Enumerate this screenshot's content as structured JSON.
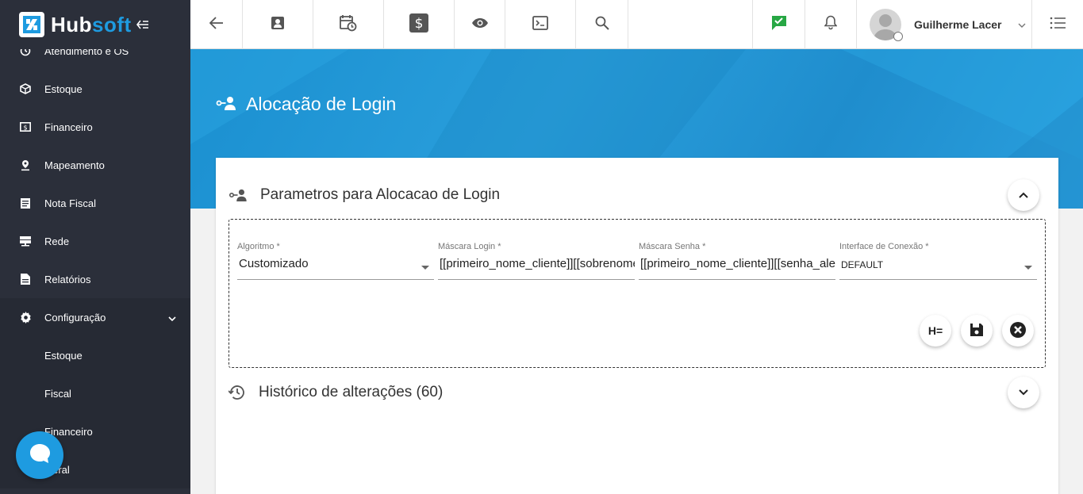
{
  "app": {
    "logo_main": "Hub",
    "logo_accent": "soft",
    "accent_color": "#1e9be0"
  },
  "sidebar": {
    "items": [
      {
        "label": "Atendimento e OS",
        "icon": "clock-icon"
      },
      {
        "label": "Estoque",
        "icon": "box-icon"
      },
      {
        "label": "Financeiro",
        "icon": "money-icon"
      },
      {
        "label": "Mapeamento",
        "icon": "map-pin-icon"
      },
      {
        "label": "Nota Fiscal",
        "icon": "document-icon"
      },
      {
        "label": "Rede",
        "icon": "network-icon"
      },
      {
        "label": "Relatórios",
        "icon": "report-icon"
      },
      {
        "label": "Configuração",
        "icon": "gear-icon"
      }
    ],
    "sub_items": [
      "Estoque",
      "Fiscal",
      "Financeiro",
      "Geral"
    ]
  },
  "topbar": {
    "user_name": "Guilherme Lacer"
  },
  "hero": {
    "title": "Alocação de Login"
  },
  "section_params": {
    "title": "Parametros para Alocacao de Login",
    "fields": [
      {
        "label": "Algoritmo *",
        "value": "Customizado"
      },
      {
        "label": "Máscara Login *",
        "value": "[[primeiro_nome_cliente]][[sobrenome_cliente]]"
      },
      {
        "label": "Máscara Senha *",
        "value": "[[primeiro_nome_cliente]][[senha_aleatoria]]"
      },
      {
        "label": "Interface de Conexão *",
        "value": "DEFAULT"
      }
    ],
    "history_button_label": "H="
  },
  "section_history": {
    "title": "Histórico de alterações (60)"
  }
}
